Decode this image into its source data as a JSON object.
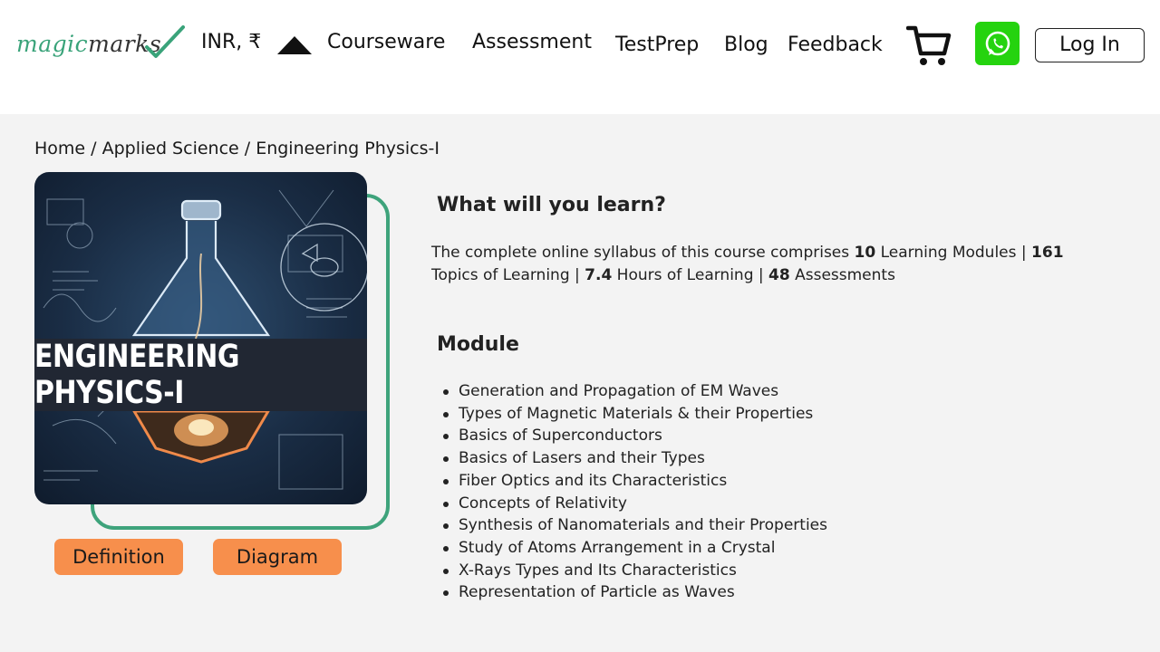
{
  "header": {
    "logo_part1": "magic",
    "logo_part2": "marks",
    "currency": "INR, ₹",
    "nav": {
      "courseware": "Courseware",
      "assessment": "Assessment",
      "testprep": "TestPrep",
      "blog": "Blog",
      "feedback": "Feedback"
    },
    "login_label": "Log In",
    "icons": [
      "caret-up-icon",
      "cart-icon",
      "whatsapp-icon"
    ]
  },
  "breadcrumb": {
    "home": "Home",
    "sep1": " / ",
    "category": "Applied Science",
    "sep2": " / ",
    "current": "Engineering Physics-I"
  },
  "course_image": {
    "title": "ENGINEERING PHYSICS-I"
  },
  "tags": {
    "definition": "Definition",
    "diagram": "Diagram"
  },
  "learn": {
    "title": "What will you learn?",
    "intro": "The complete online syllabus of this course comprises ",
    "modules_count": "10",
    "modules_label": " Learning Modules | ",
    "topics_count": "161",
    "topics_label": " Topics of Learning | ",
    "hours_count": "7.4",
    "hours_label": " Hours of Learning | ",
    "assessments_count": "48",
    "assessments_label": " Assessments"
  },
  "module": {
    "title": "Module",
    "items": [
      "Generation and Propagation of EM Waves",
      "Types of Magnetic Materials & their Properties",
      "Basics of Superconductors",
      "Basics of Lasers and their Types",
      "Fiber Optics and its Characteristics",
      "Concepts of Relativity",
      "Synthesis of Nanomaterials and their Properties",
      "Study of Atoms Arrangement in a Crystal",
      "X-Rays Types and Its Characteristics",
      "Representation of Particle as Waves"
    ]
  },
  "colors": {
    "brand_green": "#3aa37a",
    "whatsapp_green": "#25d30f",
    "tag_orange": "#f78f4c",
    "frame_green": "#3ea37b"
  }
}
